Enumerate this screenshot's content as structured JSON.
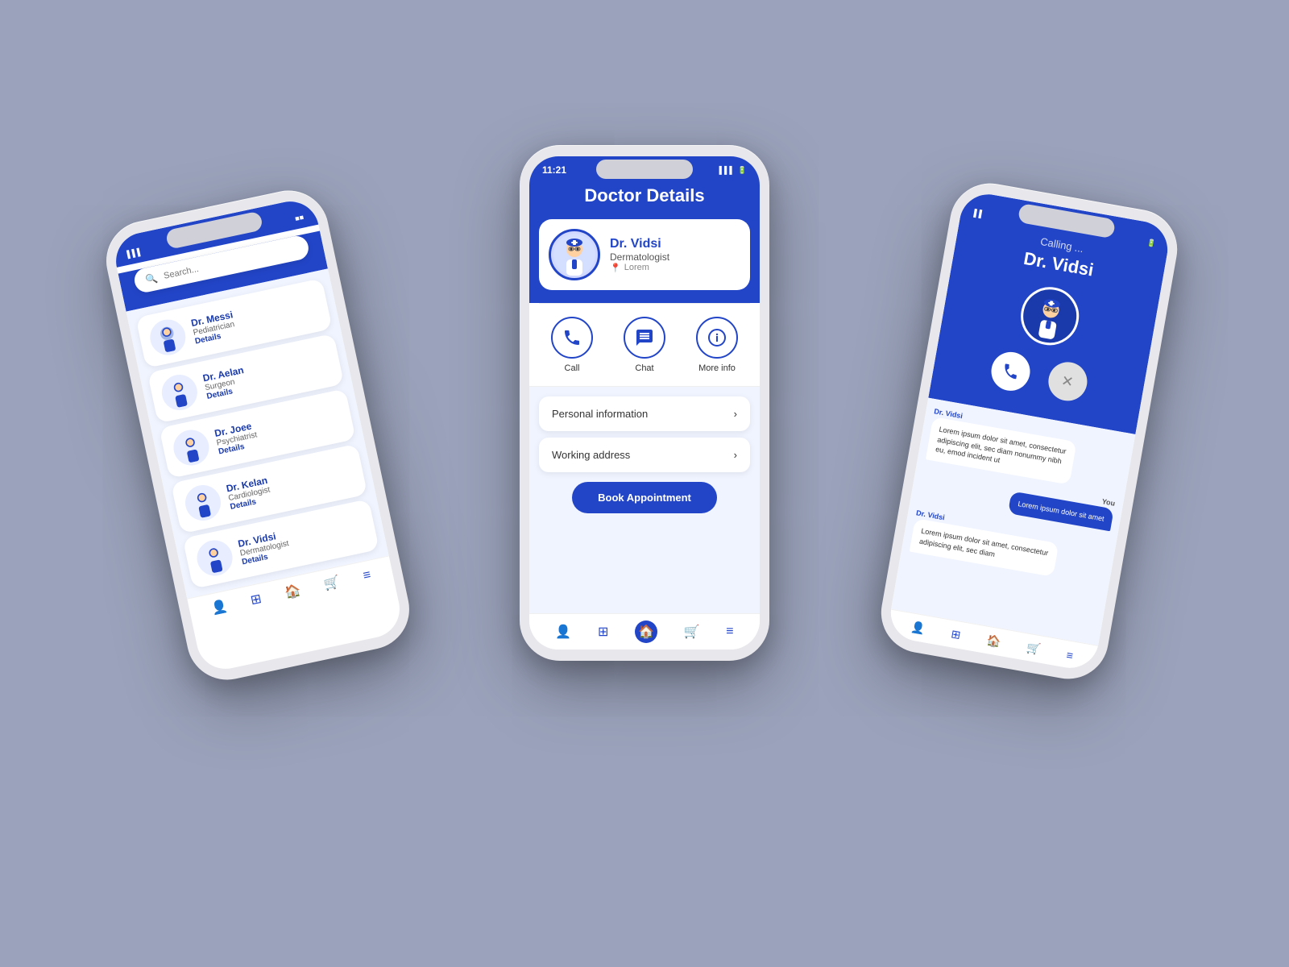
{
  "background_color": "#9ba3bc",
  "accent_color": "#2245c8",
  "phone_left": {
    "status_bar": {
      "time": "",
      "signal": "▌▌▌",
      "wifi": "⊕",
      "battery": "■"
    },
    "search_placeholder": "Search...",
    "doctors": [
      {
        "name": "Dr. Messi",
        "specialty": "Pediatrician",
        "link": "Details"
      },
      {
        "name": "Dr. Aelan",
        "specialty": "Surgeon",
        "link": "Details"
      },
      {
        "name": "Dr. Joee",
        "specialty": "Psychiatrist",
        "link": "Details"
      },
      {
        "name": "Dr. Kelan",
        "specialty": "Cardiologist",
        "link": "Details"
      },
      {
        "name": "Dr. Vidsi",
        "specialty": "Dermatologist",
        "link": "Details"
      }
    ],
    "nav_icons": [
      "person",
      "grid",
      "home",
      "cart",
      "menu"
    ]
  },
  "phone_center": {
    "status_bar": {
      "time": "11:21",
      "signal": "▌▌▌",
      "wifi": "⊕",
      "battery": "■"
    },
    "title": "Doctor Details",
    "doctor": {
      "name": "Dr. Vidsi",
      "specialty": "Dermatologist",
      "location": "Lorem"
    },
    "actions": [
      {
        "label": "Call",
        "icon": "☎"
      },
      {
        "label": "Chat",
        "icon": "💬"
      },
      {
        "label": "More info",
        "icon": "ℹ"
      }
    ],
    "info_sections": [
      {
        "label": "Personal information"
      },
      {
        "label": "Working address"
      }
    ],
    "book_btn": "Book Appointment",
    "nav_icons": [
      "person",
      "grid",
      "home",
      "cart",
      "menu"
    ]
  },
  "phone_right": {
    "status_bar": {
      "time": "",
      "signal": "▌▌",
      "wifi": "⊕",
      "battery": "■"
    },
    "calling_text": "Calling ...",
    "calling_name": "Dr. Vidsi",
    "chat_messages": [
      {
        "sender": "Dr. Vidsi",
        "side": "left",
        "text": "Lorem ipsum dolor sit amet, consectetur adipiscing elit, sec diam nonummy nibh eu, emod incident ut"
      },
      {
        "sender": "You",
        "side": "right",
        "text": "Lorem ipsum dolor sit amet"
      },
      {
        "sender": "Dr. Vidsi",
        "side": "left",
        "text": "Lorem ipsum dolor sit amet, consectetur adipiscing elit, sec diam"
      }
    ],
    "nav_icons": [
      "person",
      "grid",
      "home",
      "cart",
      "menu"
    ]
  }
}
